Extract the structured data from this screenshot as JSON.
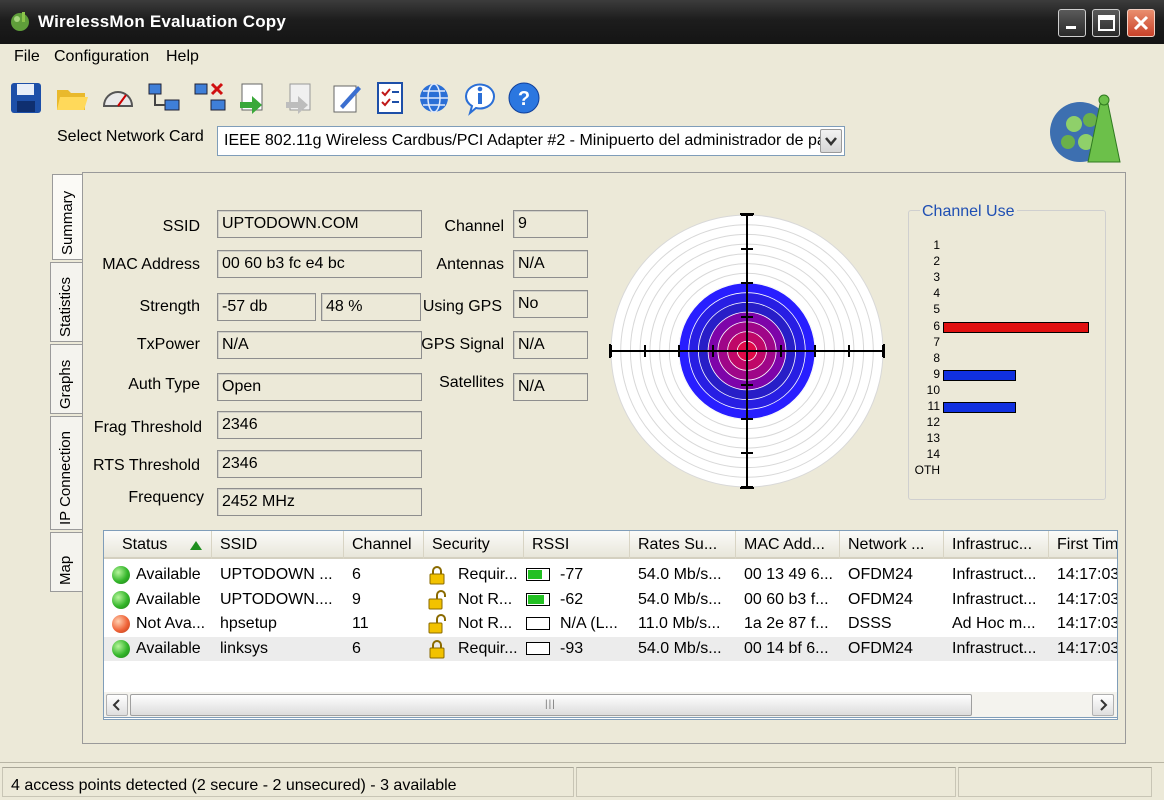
{
  "window": {
    "title": "WirelessMon Evaluation Copy"
  },
  "menu": [
    "File",
    "Configuration",
    "Help"
  ],
  "toolbar": [
    {
      "icon": "save-icon"
    },
    {
      "icon": "folder-open-icon"
    },
    {
      "icon": "gauge-icon"
    },
    {
      "icon": "connect-network-icon"
    },
    {
      "icon": "disconnect-network-icon"
    },
    {
      "icon": "log-icon"
    },
    {
      "icon": "log-disabled-icon"
    },
    {
      "icon": "edit-document-icon"
    },
    {
      "icon": "checklist-icon"
    },
    {
      "icon": "globe-icon"
    },
    {
      "icon": "info-icon"
    },
    {
      "icon": "help-icon"
    }
  ],
  "network_card": {
    "label": "Select Network Card",
    "value": "IEEE 802.11g Wireless Cardbus/PCI Adapter #2 - Minipuerto del administrador de paquetes"
  },
  "tabs": [
    "Summary",
    "Statistics",
    "Graphs",
    "IP Connection",
    "Map"
  ],
  "summary": {
    "ssid_label": "SSID",
    "ssid": "UPTODOWN.COM",
    "mac_label": "MAC Address",
    "mac": "00 60 b3 fc e4 bc",
    "strength_label": "Strength",
    "strength_db": "-57 db",
    "strength_pct": "48 %",
    "txpower_label": "TxPower",
    "txpower": "N/A",
    "auth_label": "Auth Type",
    "auth": "Open",
    "frag_label": "Frag Threshold",
    "frag": "2346",
    "rts_label": "RTS Threshold",
    "rts": "2346",
    "freq_label": "Frequency",
    "freq": "2452 MHz",
    "channel_label": "Channel",
    "channel": "9",
    "antennas_label": "Antennas",
    "antennas": "N/A",
    "gps_label": "Using GPS",
    "gps": "No",
    "gps_signal_label": "GPS Signal",
    "gps_signal": "N/A",
    "satellites_label": "Satellites",
    "satellites": "N/A"
  },
  "signal_radar": {
    "strength_fraction": 0.48
  },
  "channel_use": {
    "title": "Channel Use",
    "channels": [
      "1",
      "2",
      "3",
      "4",
      "5",
      "6",
      "7",
      "8",
      "9",
      "10",
      "11",
      "12",
      "13",
      "14",
      "OTH"
    ],
    "usage": [
      {
        "channel": "6",
        "color": "#e01010",
        "level": 1.0
      },
      {
        "channel": "9",
        "color": "#1030e0",
        "level": 0.5
      },
      {
        "channel": "11",
        "color": "#1030e0",
        "level": 0.5
      }
    ]
  },
  "list": {
    "columns": [
      "Status",
      "SSID",
      "Channel",
      "Security",
      "RSSI",
      "Rates Su...",
      "MAC Add...",
      "Network ...",
      "Infrastruc...",
      "First Tim"
    ],
    "rows": [
      {
        "status": "Available",
        "ok": true,
        "ssid": "UPTODOWN ...",
        "channel": "6",
        "locked": true,
        "security": "Requir...",
        "signal": 0.7,
        "rssi": "-77",
        "rates": "54.0 Mb/s...",
        "mac": "00 13 49 6...",
        "network": "OFDM24",
        "infra": "Infrastruct...",
        "first": "14:17:03"
      },
      {
        "status": "Available",
        "ok": true,
        "ssid": "UPTODOWN....",
        "channel": "9",
        "locked": false,
        "security": "Not R...",
        "signal": 0.8,
        "rssi": "-62",
        "rates": "54.0 Mb/s...",
        "mac": "00 60 b3 f...",
        "network": "OFDM24",
        "infra": "Infrastruct...",
        "first": "14:17:03"
      },
      {
        "status": "Not Ava...",
        "ok": false,
        "ssid": "hpsetup",
        "channel": "11",
        "locked": false,
        "security": "Not R...",
        "signal": 0,
        "rssi": "N/A (L...",
        "rates": "11.0 Mb/s...",
        "mac": "1a 2e 87 f...",
        "network": "DSSS",
        "infra": "Ad Hoc m...",
        "first": "14:17:03"
      },
      {
        "status": "Available",
        "ok": true,
        "ssid": "linksys",
        "channel": "6",
        "locked": true,
        "security": "Requir...",
        "signal": 0,
        "rssi": "-93",
        "rates": "54.0 Mb/s...",
        "mac": "00 14 bf 6...",
        "network": "OFDM24",
        "infra": "Infrastruct...",
        "first": "14:17:03"
      }
    ]
  },
  "status": {
    "text": "4 access points detected (2 secure - 2 unsecured) - 3 available"
  }
}
